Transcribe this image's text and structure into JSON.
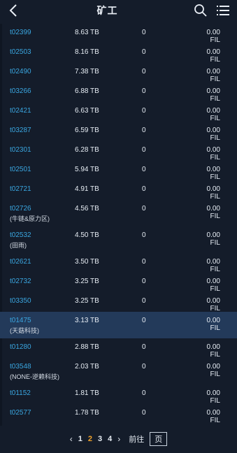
{
  "header": {
    "title": "矿工"
  },
  "rows": [
    {
      "miner": "t02399",
      "tag": "",
      "power": "8.63 TB",
      "count": "0",
      "reward": "0.00 FIL"
    },
    {
      "miner": "t02503",
      "tag": "",
      "power": "8.16 TB",
      "count": "0",
      "reward": "0.00 FIL"
    },
    {
      "miner": "t02490",
      "tag": "",
      "power": "7.38 TB",
      "count": "0",
      "reward": "0.00 FIL"
    },
    {
      "miner": "t03266",
      "tag": "",
      "power": "6.88 TB",
      "count": "0",
      "reward": "0.00 FIL"
    },
    {
      "miner": "t02421",
      "tag": "",
      "power": "6.63 TB",
      "count": "0",
      "reward": "0.00 FIL"
    },
    {
      "miner": "t03287",
      "tag": "",
      "power": "6.59 TB",
      "count": "0",
      "reward": "0.00 FIL"
    },
    {
      "miner": "t02301",
      "tag": "",
      "power": "6.28 TB",
      "count": "0",
      "reward": "0.00 FIL"
    },
    {
      "miner": "t02501",
      "tag": "",
      "power": "5.94 TB",
      "count": "0",
      "reward": "0.00 FIL"
    },
    {
      "miner": "t02721",
      "tag": "",
      "power": "4.91 TB",
      "count": "0",
      "reward": "0.00 FIL"
    },
    {
      "miner": "t02726",
      "tag": "(牛链&原力区)",
      "power": "4.56 TB",
      "count": "0",
      "reward": "0.00 FIL"
    },
    {
      "miner": "t02532",
      "tag": "(田雨)",
      "power": "4.50 TB",
      "count": "0",
      "reward": "0.00 FIL"
    },
    {
      "miner": "t02621",
      "tag": "",
      "power": "3.50 TB",
      "count": "0",
      "reward": "0.00 FIL"
    },
    {
      "miner": "t02732",
      "tag": "",
      "power": "3.25 TB",
      "count": "0",
      "reward": "0.00 FIL"
    },
    {
      "miner": "t03350",
      "tag": "",
      "power": "3.25 TB",
      "count": "0",
      "reward": "0.00 FIL"
    },
    {
      "miner": "t01475",
      "tag": "(天菇科技)",
      "power": "3.13 TB",
      "count": "0",
      "reward": "0.00 FIL",
      "highlight": true
    },
    {
      "miner": "t01280",
      "tag": "",
      "power": "2.88 TB",
      "count": "0",
      "reward": "0.00 FIL"
    },
    {
      "miner": "t03548",
      "tag": "(NONE-逆赖科技)",
      "power": "2.03 TB",
      "count": "0",
      "reward": "0.00 FIL"
    },
    {
      "miner": "t01152",
      "tag": "",
      "power": "1.81 TB",
      "count": "0",
      "reward": "0.00 FIL"
    },
    {
      "miner": "t02577",
      "tag": "",
      "power": "1.78 TB",
      "count": "0",
      "reward": "0.00 FIL"
    }
  ],
  "pagination": {
    "prev": "‹",
    "pages": [
      "1",
      "2",
      "3",
      "4"
    ],
    "active_page": "2",
    "next": "›",
    "goto_label": "前往",
    "goto_value": "页"
  },
  "colors": {
    "accent": "#3aa6e0",
    "active_page": "#f0a22b",
    "background": "#141c2a"
  }
}
